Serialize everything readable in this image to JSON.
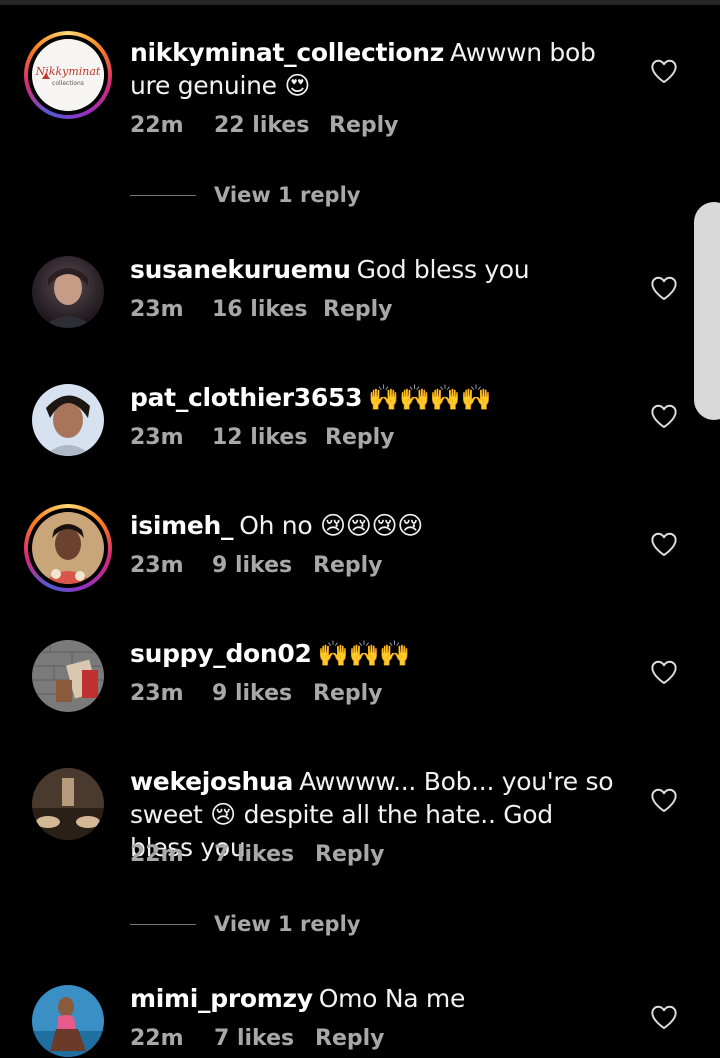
{
  "comments": [
    {
      "username": "nikkyminat_collectionz",
      "text": "Awwwn bob ure genuine 😍",
      "time": "22m",
      "likes": "22 likes",
      "reply_label": "Reply",
      "avatar_text": "Nikkyminat",
      "avatar_subtext": "collections",
      "has_story": true
    },
    {
      "username": "susanekuruemu",
      "text": "God bless you",
      "time": "23m",
      "likes": "16 likes",
      "reply_label": "Reply",
      "has_story": false
    },
    {
      "username": "pat_clothier3653",
      "text": "🙌🙌🙌🙌",
      "time": "23m",
      "likes": "12 likes",
      "reply_label": "Reply",
      "has_story": false
    },
    {
      "username": "isimeh_",
      "text": "Oh no 😢😢😢😢",
      "time": "23m",
      "likes": "9 likes",
      "reply_label": "Reply",
      "has_story": true
    },
    {
      "username": "suppy_don02",
      "text": "🙌🙌🙌",
      "time": "23m",
      "likes": "9 likes",
      "reply_label": "Reply",
      "has_story": false
    },
    {
      "username": "wekejoshua",
      "text": "Awwww... Bob... you're so sweet 😢 despite all the hate.. God bless you",
      "time": "22m",
      "likes": "7 likes",
      "reply_label": "Reply",
      "has_story": false
    },
    {
      "username": "mimi_promzy",
      "text": "Omo Na me",
      "time": "22m",
      "likes": "7 likes",
      "reply_label": "Reply",
      "has_story": false
    }
  ],
  "view_replies": [
    {
      "label": "View 1 reply"
    },
    {
      "label": "View 1 reply"
    }
  ],
  "icons": {
    "like": "heart-outline-icon"
  },
  "colors": {
    "background": "#000000",
    "text": "#ffffff",
    "secondary_text": "#a8a8a8"
  }
}
